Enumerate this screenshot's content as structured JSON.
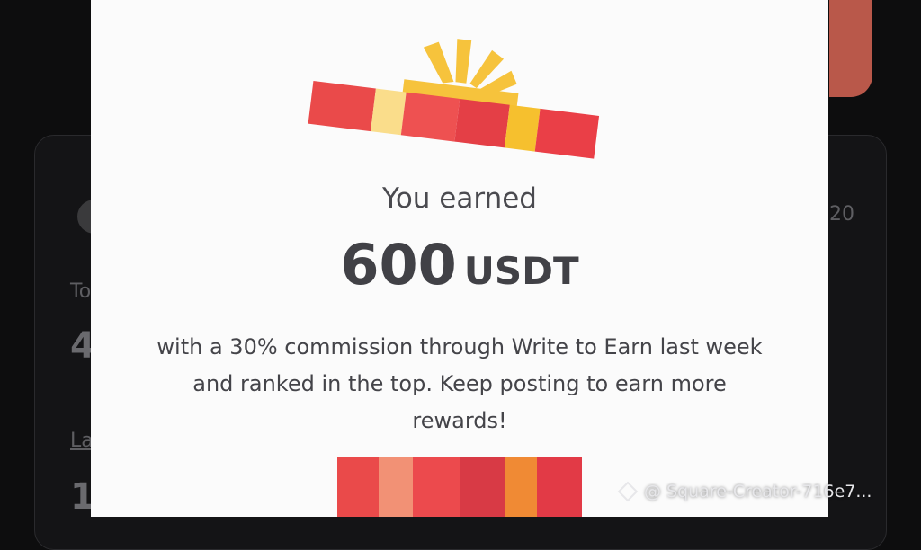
{
  "background": {
    "label_partial": "To",
    "value_partial": "4",
    "link_partial": "La",
    "value2_partial": "1",
    "right_partial": "20"
  },
  "modal": {
    "title": "You earned",
    "amount": "600",
    "currency": "USDT",
    "description": "with a 30% commission through Write to Earn last week and ranked in the top. Keep posting to earn more rewards!"
  },
  "watermark": {
    "text": "@ Square-Creator-716e7..."
  },
  "colors": {
    "gift_red": "#ea4a4a",
    "gift_yellow": "#f6c33c",
    "modal_bg": "#fbfbfb",
    "text_dark": "#414146"
  },
  "icons": {
    "gift": "gift-box-icon",
    "watermark_logo": "binance-logo-icon"
  }
}
